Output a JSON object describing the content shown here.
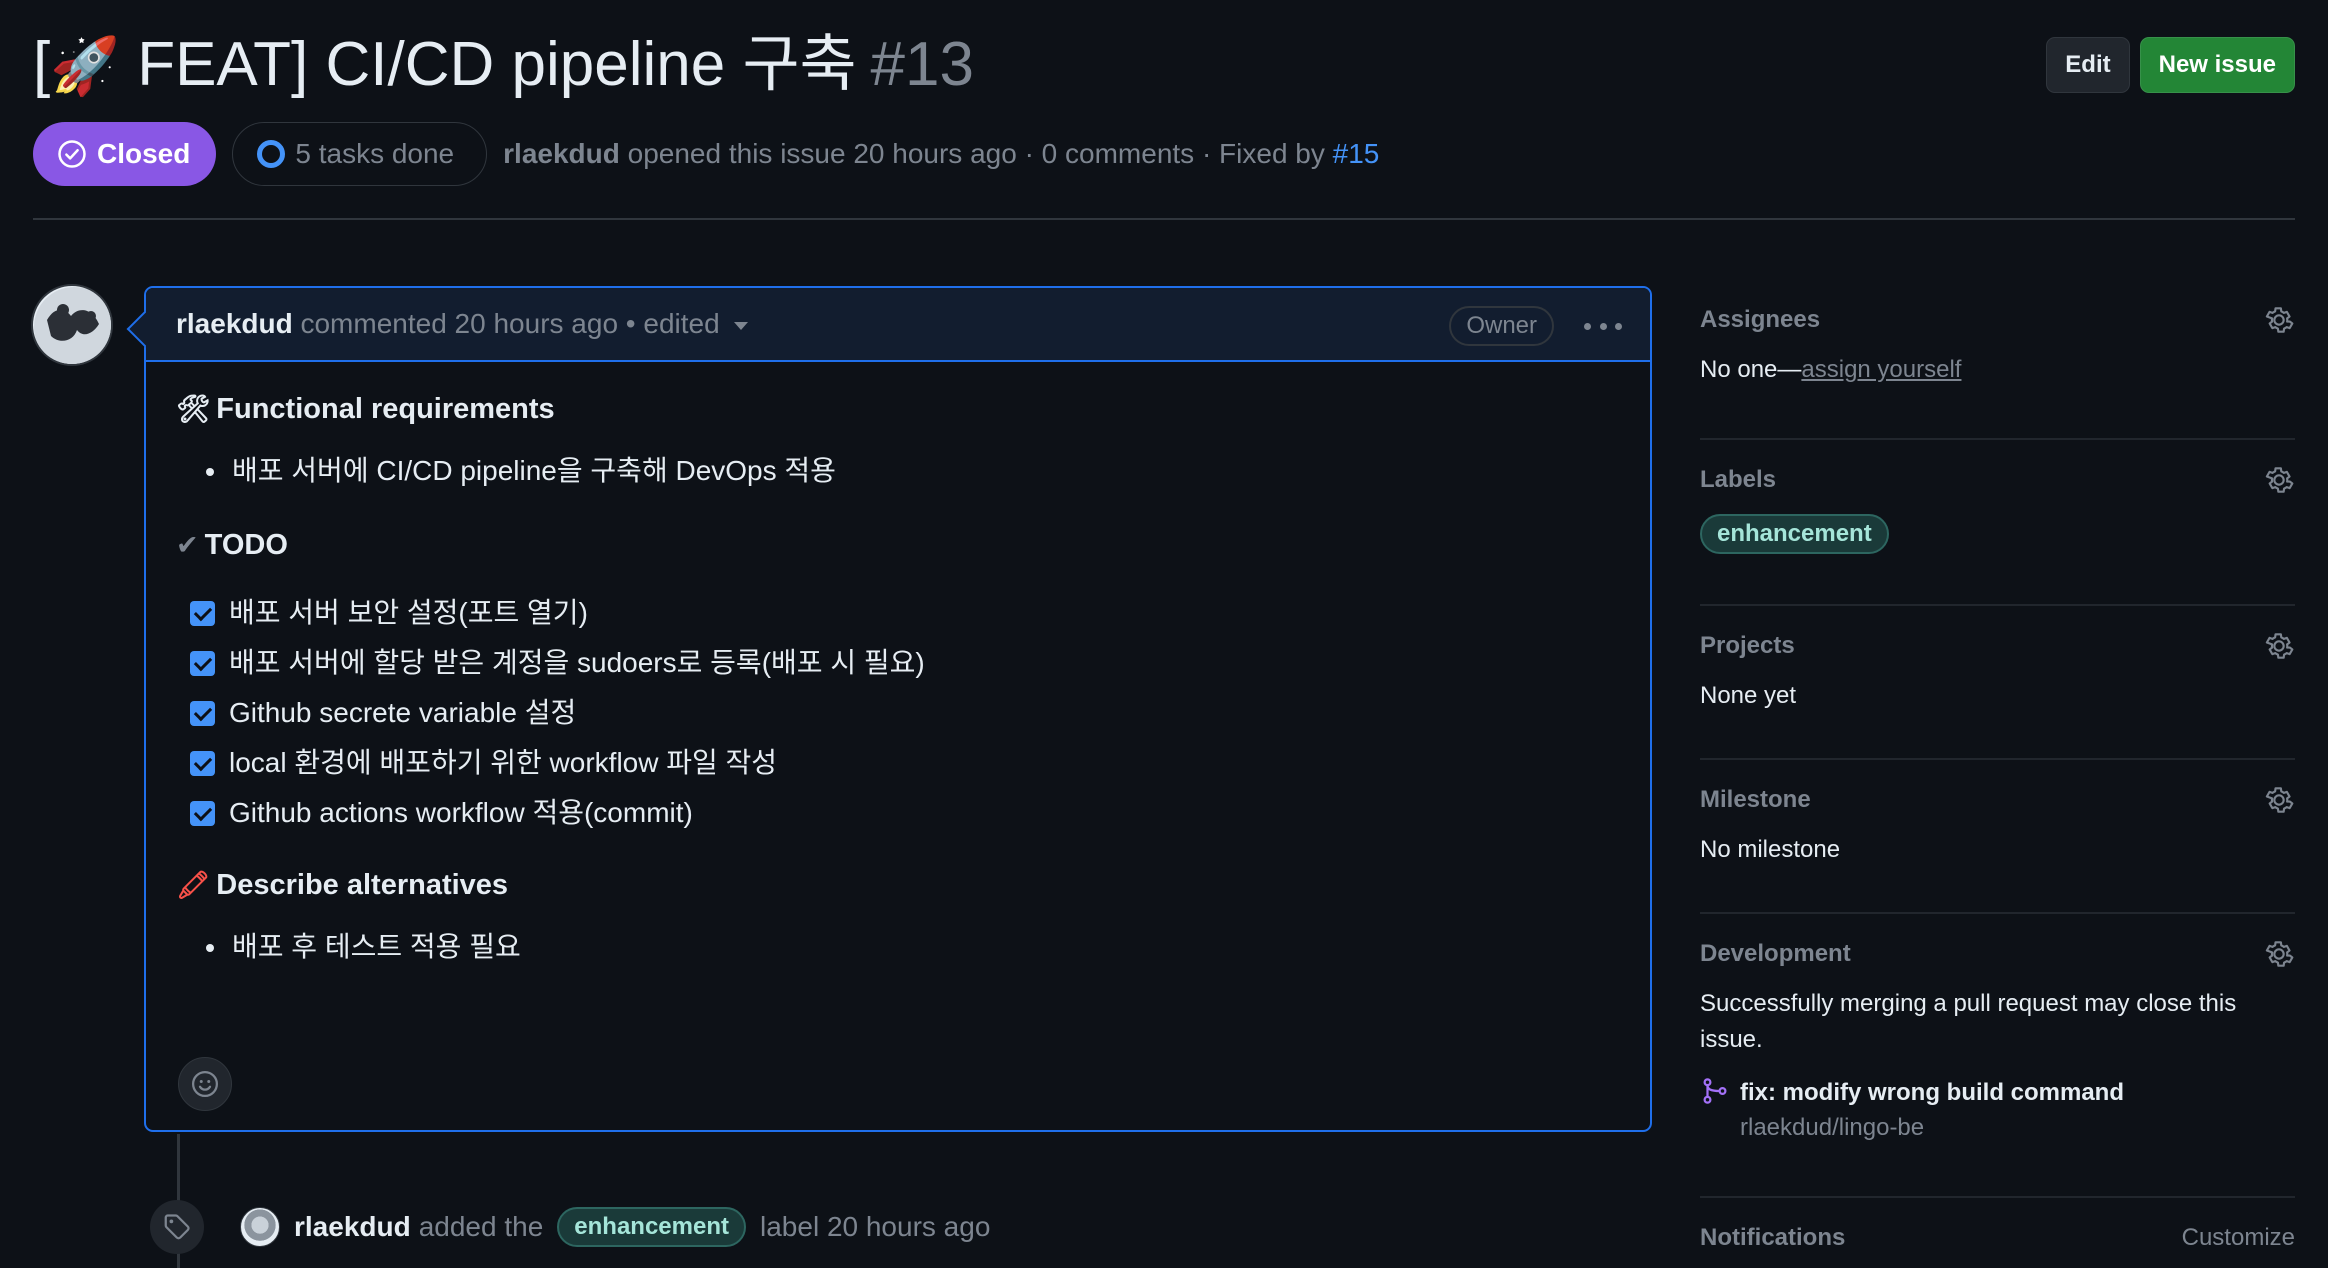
{
  "header": {
    "title_emoji": "🚀",
    "title_prefix": "[",
    "title_text": " FEAT] CI/CD pipeline 구축",
    "number": "#13",
    "edit_label": "Edit",
    "new_issue_label": "New issue"
  },
  "meta": {
    "state": "Closed",
    "tasks": "5 tasks done",
    "author": "rlaekdud",
    "opened_text": " opened this issue 20 hours ago · 0 comments · Fixed by ",
    "fixed_by": "#15"
  },
  "comment": {
    "author": "rlaekdud",
    "time_text": " commented 20 hours ago • edited",
    "owner_badge": "Owner",
    "sections": {
      "functional": {
        "icon": "🛠",
        "title": "Functional requirements",
        "items": [
          "배포 서버에 CI/CD pipeline을 구축해 DevOps 적용"
        ]
      },
      "todo": {
        "icon": "✔",
        "title": "TODO",
        "tasks": [
          "배포 서버 보안 설정(포트 열기)",
          "배포 서버에 할당 받은 계정을 sudoers로 등록(배포 시 필요)",
          "Github secrete variable 설정",
          "local 환경에 배포하기 위한 workflow 파일 작성",
          "Github actions workflow 적용(commit)"
        ]
      },
      "alternatives": {
        "icon": "🖍",
        "title": "Describe alternatives",
        "items": [
          "배포 후 테스트 적용 필요"
        ]
      }
    }
  },
  "timeline": {
    "author": "rlaekdud",
    "pre": "added the",
    "label": "enhancement",
    "post": "label 20 hours ago"
  },
  "sidebar": {
    "assignees": {
      "title": "Assignees",
      "value": "No one—",
      "link": "assign yourself"
    },
    "labels": {
      "title": "Labels",
      "label": "enhancement"
    },
    "projects": {
      "title": "Projects",
      "value": "None yet"
    },
    "milestone": {
      "title": "Milestone",
      "value": "No milestone"
    },
    "development": {
      "title": "Development",
      "value": "Successfully merging a pull request may close this issue.",
      "pr_title": "fix: modify wrong build command",
      "pr_repo": "rlaekdud/lingo-be"
    },
    "notifications": {
      "title": "Notifications",
      "customize": "Customize"
    }
  },
  "colors": {
    "background": "#0d1117",
    "closed": "#8957e5",
    "accent_blue": "#1f6feb",
    "link": "#4493f8",
    "green_button": "#238636",
    "label_bg": "#1a3a39"
  }
}
